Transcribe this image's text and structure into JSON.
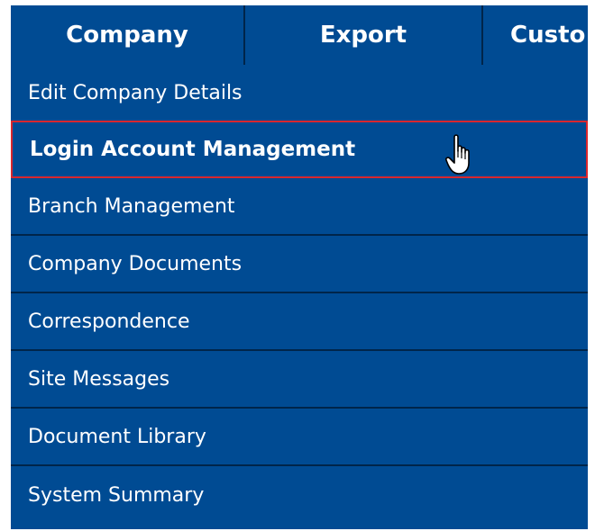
{
  "nav": {
    "tabs": [
      {
        "label": "Company"
      },
      {
        "label": "Export"
      },
      {
        "label": "Custo"
      }
    ]
  },
  "menu": {
    "items": [
      {
        "label": "Edit Company Details"
      },
      {
        "label": "Login Account Management",
        "highlighted": true
      },
      {
        "label": "Branch Management"
      },
      {
        "label": "Company Documents"
      },
      {
        "label": "Correspondence"
      },
      {
        "label": "Site Messages"
      },
      {
        "label": "Document Library"
      },
      {
        "label": "System Summary"
      }
    ]
  },
  "colors": {
    "menu_bg": "#004b93",
    "divider": "#00254a",
    "highlight_border": "#d9272e",
    "text": "#ffffff"
  },
  "cursor": {
    "icon": "hand-pointer-icon"
  }
}
